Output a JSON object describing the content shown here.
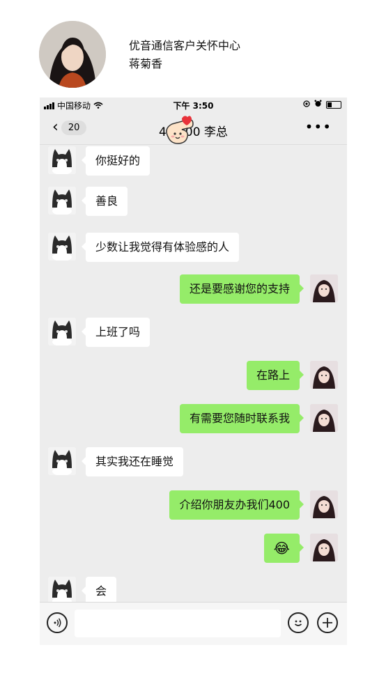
{
  "profile": {
    "org": "优音通信客户关怀中心",
    "name": "蒋菊香"
  },
  "status_bar": {
    "carrier": "中国移动",
    "time": "下午 3:50"
  },
  "nav": {
    "back_count": "20",
    "title": "400 00 李总",
    "more": "•••"
  },
  "messages": [
    {
      "side": "left",
      "text": "你挺好的"
    },
    {
      "side": "left",
      "text": "善良"
    },
    {
      "side": "left",
      "text": "少数让我觉得有体验感的人"
    },
    {
      "side": "right",
      "text": "还是要感谢您的支持"
    },
    {
      "side": "left",
      "text": "上班了吗"
    },
    {
      "side": "right",
      "text": "在路上"
    },
    {
      "side": "right",
      "text": "有需要您随时联系我"
    },
    {
      "side": "left",
      "text": "其实我还在睡觉"
    },
    {
      "side": "right",
      "text": "介绍你朋友办我们400"
    },
    {
      "side": "right",
      "text": "😂"
    },
    {
      "side": "left",
      "text": "会"
    }
  ],
  "input_bar": {
    "voice_icon": "voice-icon",
    "emoji_icon": "smiley-icon",
    "plus_icon": "plus-icon"
  },
  "colors": {
    "chat_bg": "#ededed",
    "left_bubble": "#ffffff",
    "right_bubble": "#95ec69"
  }
}
